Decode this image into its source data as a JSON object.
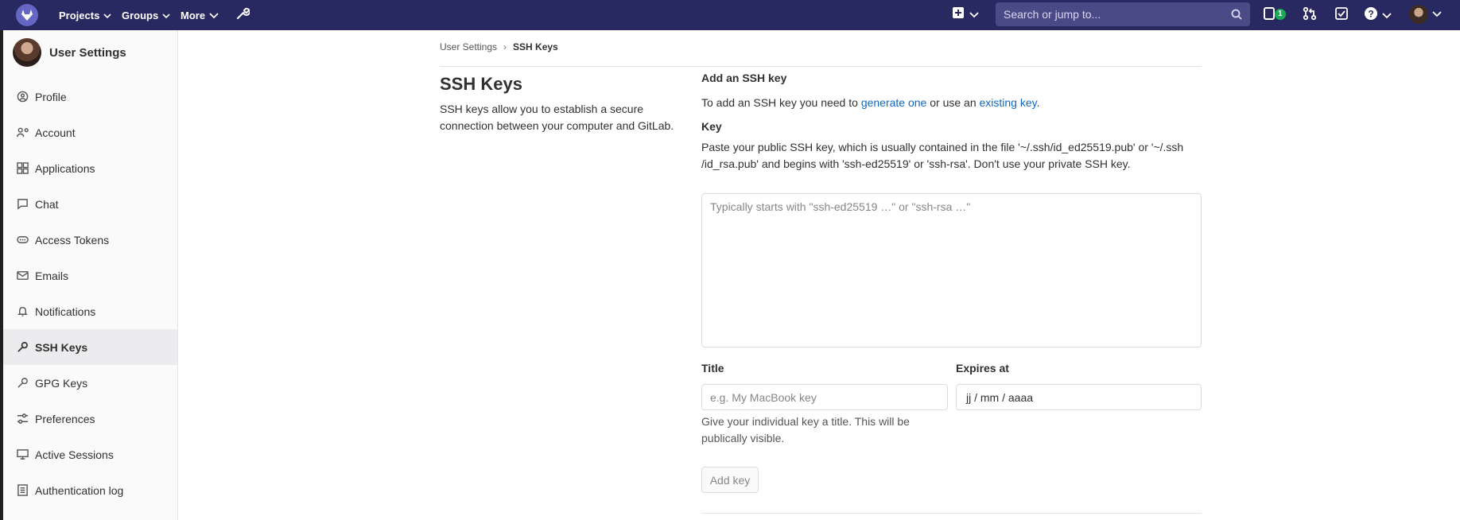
{
  "topbar": {
    "nav": [
      {
        "label": "Projects"
      },
      {
        "label": "Groups"
      },
      {
        "label": "More"
      }
    ],
    "search_placeholder": "Search or jump to...",
    "todo_badge": "1",
    "icons": [
      "gitlab-logo-icon",
      "wrench-icon",
      "plus-square-icon",
      "search-icon",
      "issues-icon",
      "merge-request-icon",
      "todo-icon",
      "help-icon",
      "user-avatar"
    ]
  },
  "sidebar": {
    "title": "User Settings",
    "items": [
      {
        "label": "Profile",
        "icon": "profile-icon"
      },
      {
        "label": "Account",
        "icon": "account-icon"
      },
      {
        "label": "Applications",
        "icon": "applications-icon"
      },
      {
        "label": "Chat",
        "icon": "chat-icon"
      },
      {
        "label": "Access Tokens",
        "icon": "token-icon"
      },
      {
        "label": "Emails",
        "icon": "mail-icon"
      },
      {
        "label": "Notifications",
        "icon": "bell-icon"
      },
      {
        "label": "SSH Keys",
        "icon": "key-icon",
        "active": true
      },
      {
        "label": "GPG Keys",
        "icon": "key-icon"
      },
      {
        "label": "Preferences",
        "icon": "preferences-icon"
      },
      {
        "label": "Active Sessions",
        "icon": "monitor-icon"
      },
      {
        "label": "Authentication log",
        "icon": "log-icon"
      }
    ]
  },
  "breadcrumb": {
    "parent": "User Settings",
    "current": "SSH Keys"
  },
  "page": {
    "title": "SSH Keys",
    "description": "SSH keys allow you to establish a secure connection between your computer and GitLab."
  },
  "form": {
    "heading": "Add an SSH key",
    "intro_prefix": "To add an SSH key you need to",
    "generate_link": "generate one",
    "intro_middle": "or use an",
    "existing_link": "existing key",
    "key_label": "Key",
    "key_help": "Paste your public SSH key, which is usually contained in the file '~/.ssh/id_ed25519.pub' or '~/.ssh /id_rsa.pub' and begins with 'ssh-ed25519' or 'ssh-rsa'. Don't use your private SSH key.",
    "key_placeholder": "Typically starts with \"ssh-ed25519 …\" or \"ssh-rsa …\"",
    "title_label": "Title",
    "title_placeholder": "e.g. My MacBook key",
    "title_help": "Give your individual key a title. This will be publically visible.",
    "expires_label": "Expires at",
    "expires_value": "jj / mm / aaaa",
    "add_button": "Add key"
  }
}
